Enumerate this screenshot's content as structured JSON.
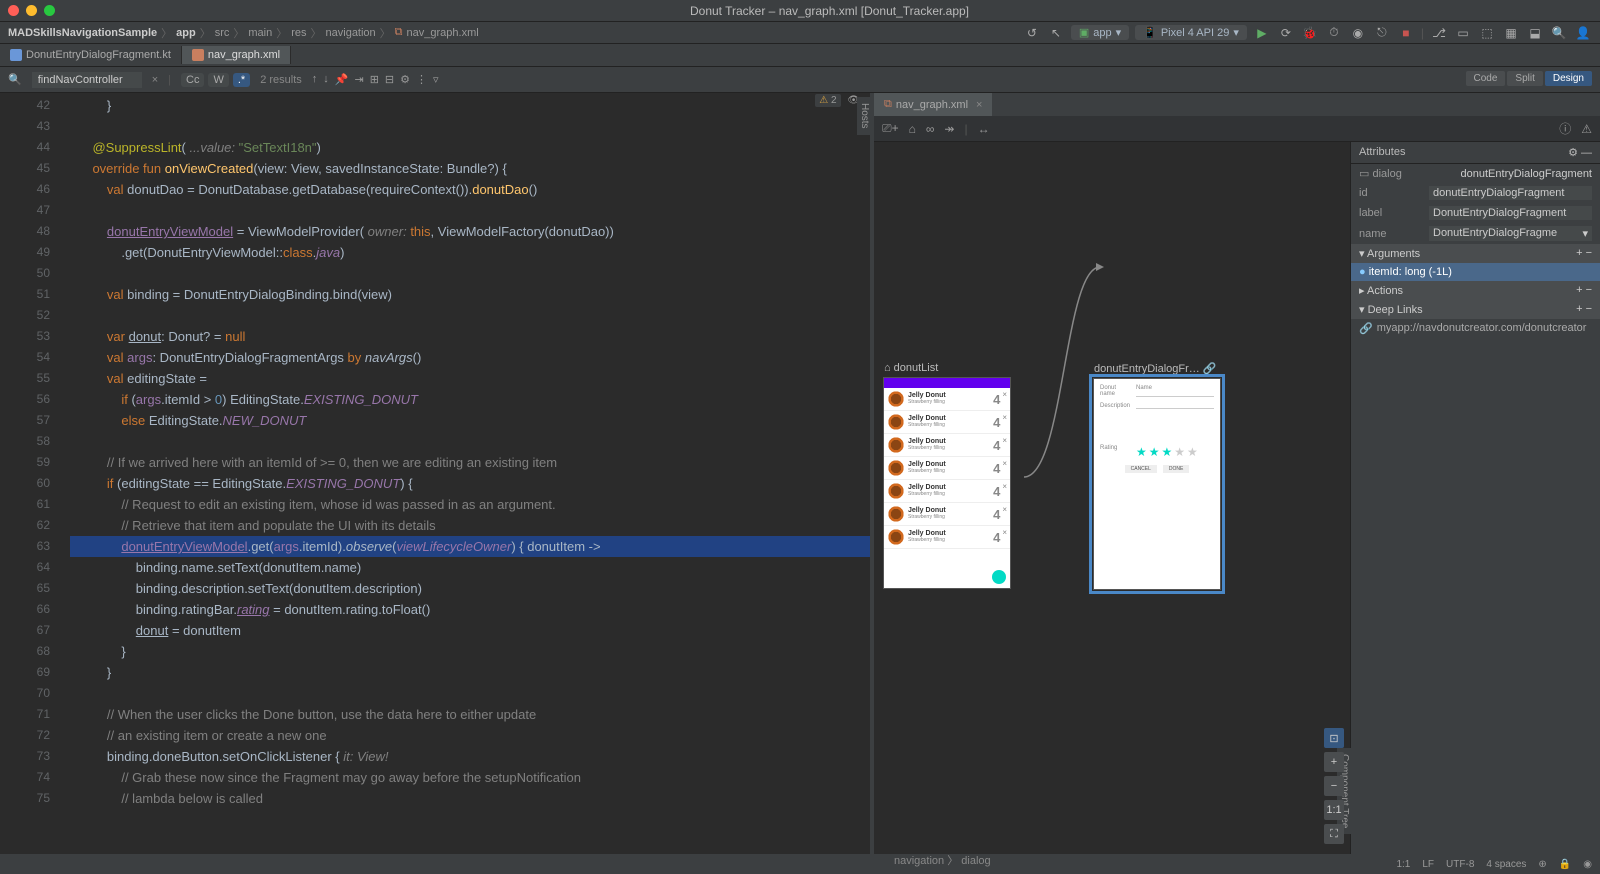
{
  "window": {
    "title": "Donut Tracker – nav_graph.xml [Donut_Tracker.app]"
  },
  "breadcrumb": [
    "MADSkillsNavigationSample",
    "app",
    "src",
    "main",
    "res",
    "navigation",
    "nav_graph.xml"
  ],
  "run_config": {
    "app_label": "app",
    "device_label": "Pixel 4 API 29"
  },
  "editor_tabs": [
    {
      "label": "DonutEntryDialogFragment.kt",
      "color": "#6a97d8"
    },
    {
      "label": "nav_graph.xml",
      "color": "#c97f5f",
      "active": true
    }
  ],
  "designer_tab": {
    "label": "nav_graph.xml"
  },
  "view_modes": {
    "code": "Code",
    "split": "Split",
    "design": "Design"
  },
  "find": {
    "query": "findNavController",
    "cc": "Cc",
    "w": "W",
    "star": ".*",
    "results": "2 results"
  },
  "editor_status": {
    "warn_icon": "⚠",
    "warn_count": "2",
    "eye": "👁"
  },
  "lines": [
    {
      "n": 42,
      "html": "        }"
    },
    {
      "n": 43,
      "html": ""
    },
    {
      "n": 44,
      "html": "    <span class='ann'>@SuppressLint</span>( <span class='param'>...value:</span> <span class='str'>\"SetTextI18n\"</span>)"
    },
    {
      "n": 45,
      "html": "    <span class='kw'>override fun</span> <span class='fn'>onViewCreated</span>(view: View, savedInstanceState: Bundle?) {"
    },
    {
      "n": 46,
      "html": "        <span class='kw'>val</span> donutDao = DonutDatabase.getDatabase(requireContext()).<span class='fn'>donutDao</span>()"
    },
    {
      "n": 47,
      "html": ""
    },
    {
      "n": 48,
      "html": "        <span class='purple under'>donutEntryViewModel</span> = ViewModelProvider( <span class='param'>owner:</span> <span class='kw'>this</span>, ViewModelFactory(donutDao))"
    },
    {
      "n": 49,
      "html": "            .get(DonutEntryViewModel::<span class='kw'>class</span>.<span class='purple ital'>java</span>)"
    },
    {
      "n": 50,
      "html": ""
    },
    {
      "n": 51,
      "html": "        <span class='kw'>val</span> binding = DonutEntryDialogBinding.bind(view)"
    },
    {
      "n": 52,
      "html": ""
    },
    {
      "n": 53,
      "html": "        <span class='kw'>var</span> <span class='under'>donut</span>: Donut? = <span class='kw'>null</span>"
    },
    {
      "n": 54,
      "html": "        <span class='kw'>val</span> <span class='purple'>args</span>: DonutEntryDialogFragmentArgs <span class='kw'>by</span> <span class='ital'>navArgs</span>()"
    },
    {
      "n": 55,
      "html": "        <span class='kw'>val</span> editingState ="
    },
    {
      "n": 56,
      "html": "            <span class='kw'>if</span> (<span class='purple'>args</span>.itemId > <span class='num'>0</span>) EditingState.<span class='purple ital'>EXISTING_DONUT</span>"
    },
    {
      "n": 57,
      "html": "            <span class='kw'>else</span> EditingState.<span class='purple ital'>NEW_DONUT</span>"
    },
    {
      "n": 58,
      "html": ""
    },
    {
      "n": 59,
      "html": "        <span class='cmt'>// If we arrived here with an itemId of &gt;= 0, then we are editing an existing item</span>"
    },
    {
      "n": 60,
      "html": "        <span class='kw'>if</span> (editingState == EditingState.<span class='purple ital'>EXISTING_DONUT</span>) {"
    },
    {
      "n": 61,
      "html": "            <span class='cmt'>// Request to edit an existing item, whose id was passed in as an argument.</span>"
    },
    {
      "n": 62,
      "html": "            <span class='cmt'>// Retrieve that item and populate the UI with its details</span>"
    },
    {
      "n": 63,
      "hl": true,
      "html": "            <span class='purple under'>donutEntryViewModel</span>.get(<span class='purple'>args</span>.itemId).<span class='ital'>observe</span>(<span class='purple ital'>viewLifecycleOwner</span>) { donutItem -&gt;"
    },
    {
      "n": 64,
      "html": "                binding.name.setText(donutItem.name)"
    },
    {
      "n": 65,
      "html": "                binding.description.setText(donutItem.description)"
    },
    {
      "n": 66,
      "html": "                binding.ratingBar.<span class='purple ital under'>rating</span> = donutItem.rating.toFloat()"
    },
    {
      "n": 67,
      "html": "                <span class='under'>donut</span> = donutItem"
    },
    {
      "n": 68,
      "html": "            }"
    },
    {
      "n": 69,
      "html": "        }"
    },
    {
      "n": 70,
      "html": ""
    },
    {
      "n": 71,
      "html": "        <span class='cmt'>// When the user clicks the Done button, use the data here to either update</span>"
    },
    {
      "n": 72,
      "html": "        <span class='cmt'>// an existing item or create a new one</span>"
    },
    {
      "n": 73,
      "html": "        binding.doneButton.setOnClickListener { <span class='param'>it: View!</span>"
    },
    {
      "n": 74,
      "html": "            <span class='cmt'>// Grab these now since the Fragment may go away before the setupNotification</span>"
    },
    {
      "n": 75,
      "html": "            <span class='cmt'>// lambda below is called</span>"
    }
  ],
  "designer": {
    "dest1": {
      "label": "donutList",
      "home_icon": "⌂",
      "donut": {
        "title": "Jelly Donut",
        "sub": "Strawberry filling",
        "rating": "4"
      }
    },
    "dest2": {
      "label": "donutEntryDialogFr…",
      "link_icon": "🔗",
      "name_lbl": "Donut name",
      "name_ph": "Name",
      "desc_lbl": "Description",
      "rating_lbl": "Rating",
      "cancel": "CANCEL",
      "done": "DONE"
    },
    "bottom_crumb": "navigation 〉 dialog"
  },
  "attrs": {
    "title": "Attributes",
    "type_icon": "▭",
    "type": "dialog",
    "type_val": "donutEntryDialogFragment",
    "rows": [
      {
        "k": "id",
        "v": "donutEntryDialogFragment"
      },
      {
        "k": "label",
        "v": "DonutEntryDialogFragment"
      },
      {
        "k": "name",
        "v": "DonutEntryDialogFragme",
        "drop": true
      }
    ],
    "sections": {
      "arguments": "Arguments",
      "arg_item": "itemId: long (-1L)",
      "actions": "Actions",
      "deeplinks": "Deep Links"
    },
    "deeplink": "myapp://navdonutcreator.com/donutcreator"
  },
  "zoom": {
    "reset": "⊡",
    "plus": "+",
    "minus": "−",
    "fit": "1:1",
    "expand": "⛶"
  },
  "statusbar": {
    "pos": "1:1",
    "le": "LF",
    "enc": "UTF-8",
    "indent": "4 spaces"
  },
  "side_tabs": {
    "hosts": "Hosts",
    "comp_tree": "Component Tree"
  }
}
